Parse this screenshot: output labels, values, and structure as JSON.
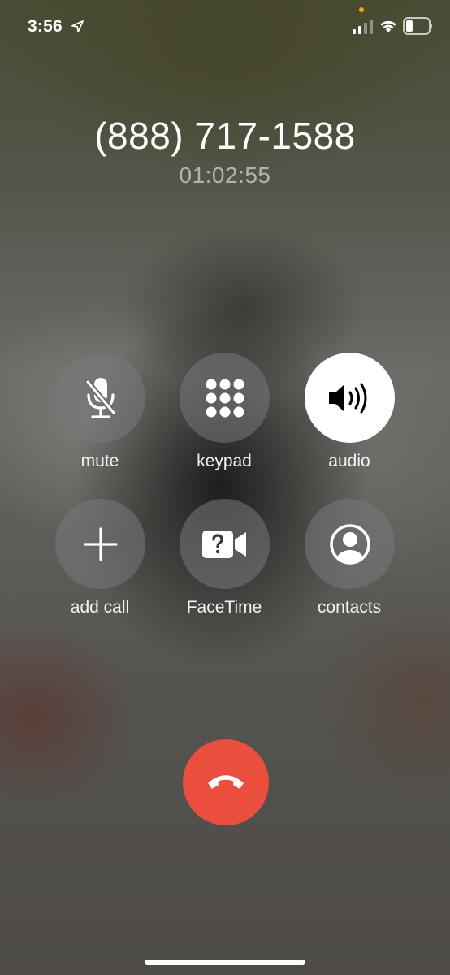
{
  "status_bar": {
    "time": "3:56",
    "icons": [
      "location-arrow-icon",
      "cellular-signal-icon",
      "wifi-icon",
      "battery-icon"
    ],
    "indicator_dot_color": "#ff9f0a"
  },
  "call": {
    "number": "(888) 717-1588",
    "duration": "01:02:55"
  },
  "controls": {
    "mute": {
      "label": "mute",
      "icon": "microphone-slash-icon",
      "active": false
    },
    "keypad": {
      "label": "keypad",
      "icon": "keypad-grid-icon",
      "active": false
    },
    "audio": {
      "label": "audio",
      "icon": "speaker-icon",
      "active": true
    },
    "add_call": {
      "label": "add call",
      "icon": "plus-icon",
      "active": false
    },
    "facetime": {
      "label": "FaceTime",
      "icon": "facetime-camera-question-icon",
      "active": false
    },
    "contacts": {
      "label": "contacts",
      "icon": "person-circle-icon",
      "active": false
    }
  },
  "end_call": {
    "icon": "phone-hangup-icon",
    "color": "#eb4e3d"
  },
  "colors": {
    "control_background": "rgba(120,120,120,0.55)",
    "active_control_background": "#ffffff",
    "duration_text": "rgba(255,255,255,0.55)"
  }
}
